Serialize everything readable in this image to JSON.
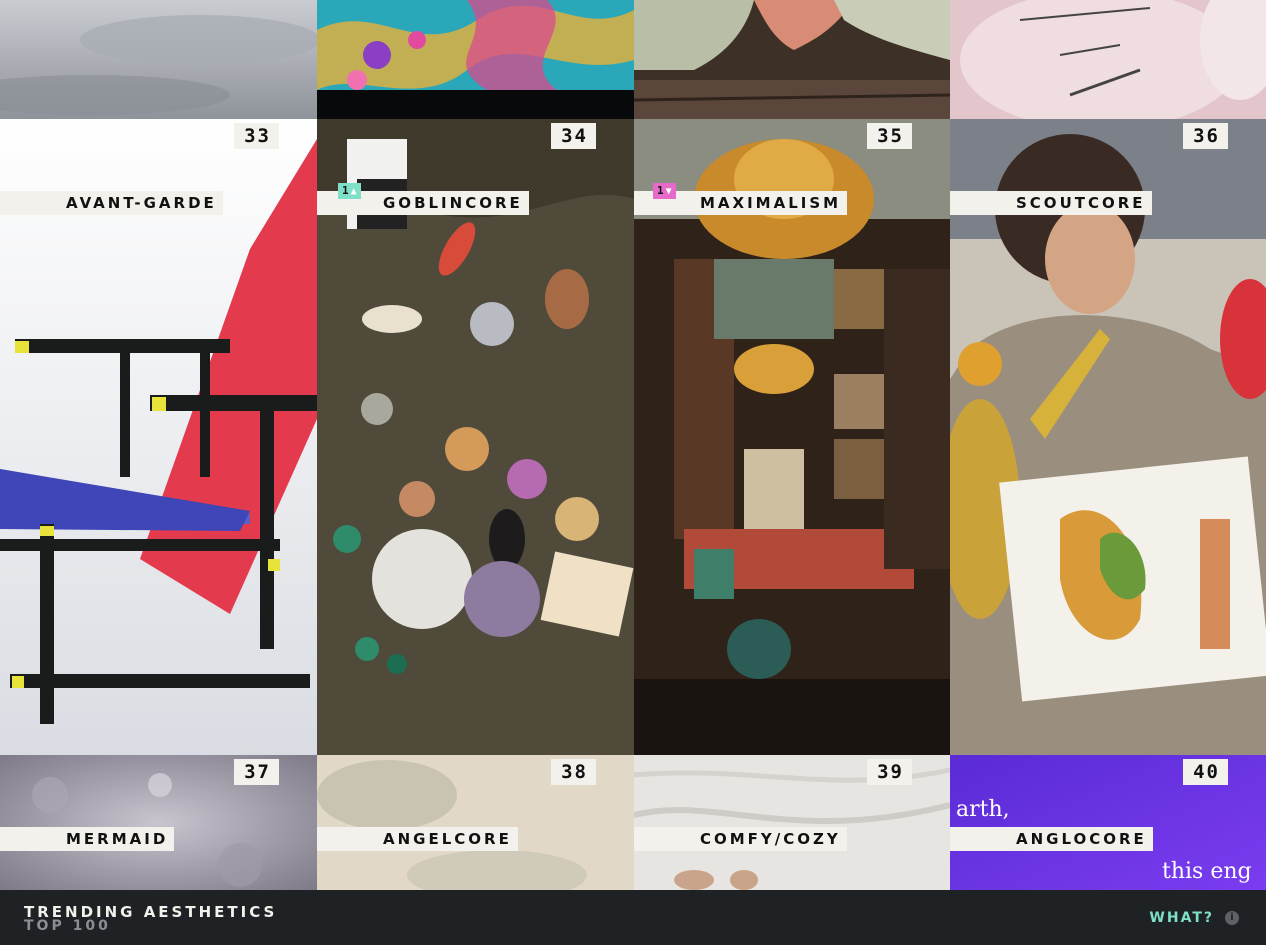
{
  "top_row": [
    {
      "name": "sky-photo"
    },
    {
      "name": "psychedelic-painting"
    },
    {
      "name": "satin-gowns-photo"
    },
    {
      "name": "pink-text-photo"
    }
  ],
  "tiles": [
    {
      "rank": "33",
      "label": "AVANT-GARDE",
      "move": null
    },
    {
      "rank": "34",
      "label": "GOBLINCORE",
      "move": {
        "count": "1",
        "dir": "up",
        "arrow": "▲"
      }
    },
    {
      "rank": "35",
      "label": "MAXIMALISM",
      "move": {
        "count": "1",
        "dir": "down",
        "arrow": "▼"
      }
    },
    {
      "rank": "36",
      "label": "SCOUTCORE",
      "move": null
    },
    {
      "rank": "37",
      "label": "MERMAID",
      "move": null
    },
    {
      "rank": "38",
      "label": "ANGELCORE",
      "move": null
    },
    {
      "rank": "39",
      "label": "COMFY/COZY",
      "move": null
    },
    {
      "rank": "40",
      "label": "ANGLOCORE",
      "move": null
    }
  ],
  "anglocore_text": [
    "arth,",
    "this eng"
  ],
  "footer": {
    "title": "TRENDING AESTHETICS",
    "subtitle": "TOP 100",
    "what_label": "WHAT?",
    "info_icon": "i"
  },
  "colors": {
    "accent_up": "#7fe0c8",
    "accent_down": "#e56ac9",
    "label_bg": "#f3f1ec",
    "footer_bg": "#1f2224"
  }
}
